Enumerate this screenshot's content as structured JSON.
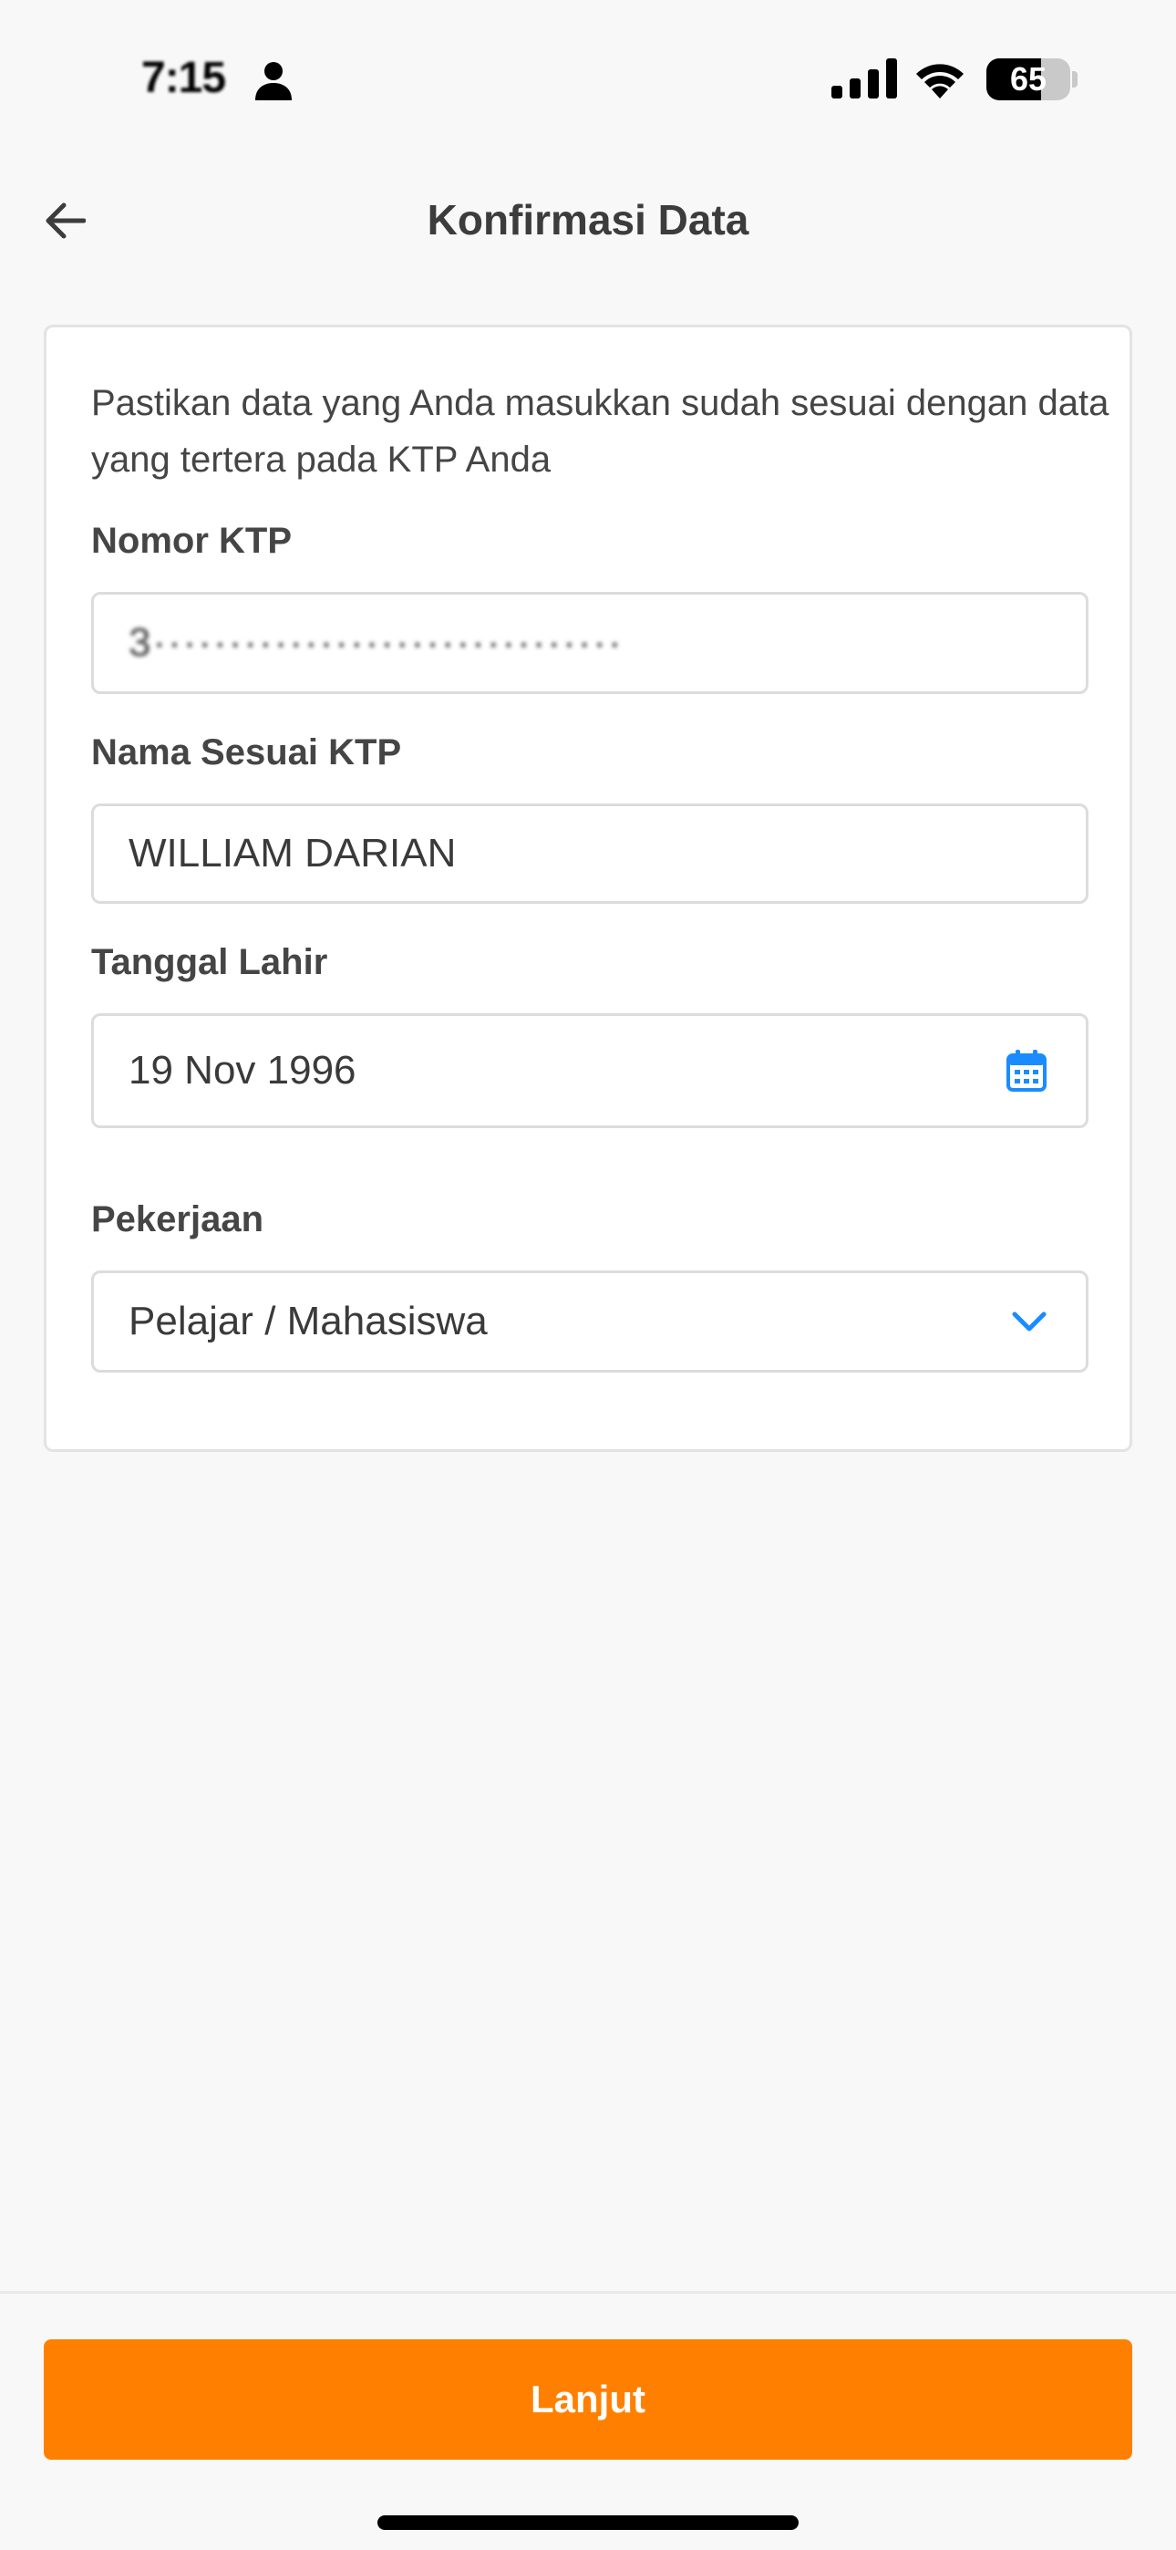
{
  "status_bar": {
    "time": "7:15",
    "battery_percent": 65,
    "battery_label": "65",
    "icons": [
      "person-icon",
      "signal-icon",
      "wifi-icon",
      "battery-icon"
    ]
  },
  "header": {
    "back_icon": "arrow-left-icon",
    "title": "Konfirmasi Data"
  },
  "form": {
    "intro": "Pastikan data yang Anda masukkan sudah sesuai dengan data yang tertera pada KTP Anda",
    "ktp": {
      "label": "Nomor KTP",
      "value": "3·······························"
    },
    "name": {
      "label": "Nama Sesuai KTP",
      "value": "WILLIAM DARIAN"
    },
    "dob": {
      "label": "Tanggal Lahir",
      "value": "19 Nov 1996",
      "icon": "calendar-icon"
    },
    "job": {
      "label": "Pekerjaan",
      "value": "Pelajar / Mahasiswa",
      "icon": "chevron-down-icon"
    }
  },
  "footer": {
    "continue_label": "Lanjut"
  },
  "colors": {
    "accent": "#ff8000",
    "icon_blue": "#1a8cff",
    "background": "#f8f8f8",
    "text": "#404040"
  }
}
